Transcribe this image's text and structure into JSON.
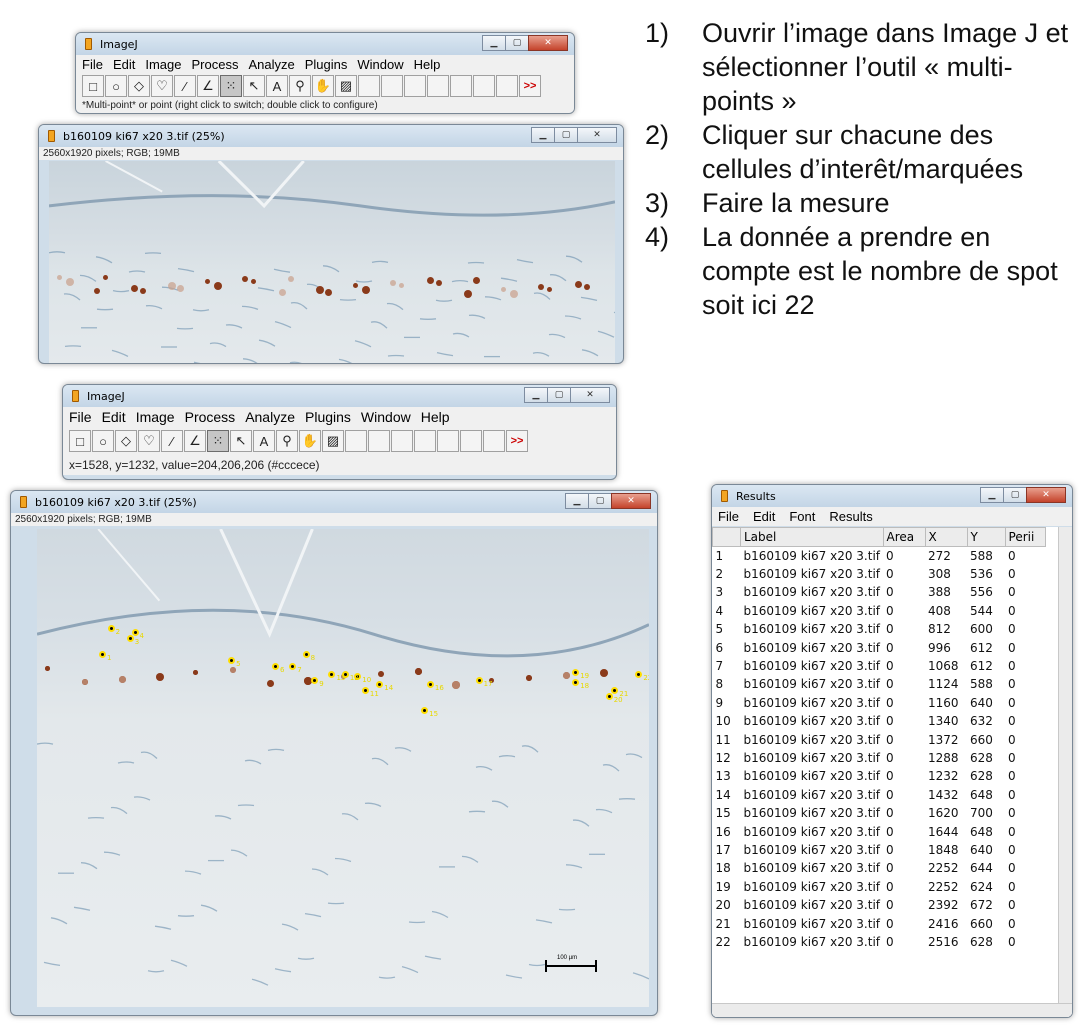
{
  "imagej1": {
    "title": "ImageJ",
    "menu": [
      "File",
      "Edit",
      "Image",
      "Process",
      "Analyze",
      "Plugins",
      "Window",
      "Help"
    ],
    "status": "*Multi-point* or point (right click to switch; double click to configure)"
  },
  "imgwin1": {
    "title": "b160109 ki67 x20 3.tif (25%)",
    "info": "2560x1920 pixels; RGB; 19MB"
  },
  "imagej2": {
    "title": "ImageJ",
    "menu": [
      "File",
      "Edit",
      "Image",
      "Process",
      "Analyze",
      "Plugins",
      "Window",
      "Help"
    ],
    "status": "x=1528, y=1232, value=204,206,206 (#cccece)"
  },
  "imgwin2": {
    "title": "b160109 ki67 x20 3.tif (25%)",
    "info": "2560x1920 pixels; RGB; 19MB",
    "scale_label": "100 µm"
  },
  "tool_more": ">>",
  "tools": [
    "rect-icon",
    "oval-icon",
    "polygon-icon",
    "freehand-icon",
    "line-icon",
    "angle-icon",
    "multipoint-icon",
    "wand-icon",
    "text-icon",
    "zoom-icon",
    "hand-icon",
    "dropper-icon"
  ],
  "instructions": [
    {
      "num": "1)",
      "text": "Ouvrir l’image dans Image J et sélectionner l’outil « multi-points »"
    },
    {
      "num": "2)",
      "text": "Cliquer sur chacune des cellules d’interêt/marquées"
    },
    {
      "num": "3)",
      "text": "Faire la mesure"
    },
    {
      "num": "4)",
      "text": "La donnée a prendre en compte est le nombre de spot soit ici 22"
    }
  ],
  "results": {
    "title": "Results",
    "menu": [
      "File",
      "Edit",
      "Font",
      "Results"
    ],
    "columns": [
      "",
      "Label",
      "Area",
      "X",
      "Y",
      "Perii"
    ],
    "rows": [
      [
        "1",
        "b160109 ki67 x20 3.tif",
        "0",
        "272",
        "588",
        "0"
      ],
      [
        "2",
        "b160109 ki67 x20 3.tif",
        "0",
        "308",
        "536",
        "0"
      ],
      [
        "3",
        "b160109 ki67 x20 3.tif",
        "0",
        "388",
        "556",
        "0"
      ],
      [
        "4",
        "b160109 ki67 x20 3.tif",
        "0",
        "408",
        "544",
        "0"
      ],
      [
        "5",
        "b160109 ki67 x20 3.tif",
        "0",
        "812",
        "600",
        "0"
      ],
      [
        "6",
        "b160109 ki67 x20 3.tif",
        "0",
        "996",
        "612",
        "0"
      ],
      [
        "7",
        "b160109 ki67 x20 3.tif",
        "0",
        "1068",
        "612",
        "0"
      ],
      [
        "8",
        "b160109 ki67 x20 3.tif",
        "0",
        "1124",
        "588",
        "0"
      ],
      [
        "9",
        "b160109 ki67 x20 3.tif",
        "0",
        "1160",
        "640",
        "0"
      ],
      [
        "10",
        "b160109 ki67 x20 3.tif",
        "0",
        "1340",
        "632",
        "0"
      ],
      [
        "11",
        "b160109 ki67 x20 3.tif",
        "0",
        "1372",
        "660",
        "0"
      ],
      [
        "12",
        "b160109 ki67 x20 3.tif",
        "0",
        "1288",
        "628",
        "0"
      ],
      [
        "13",
        "b160109 ki67 x20 3.tif",
        "0",
        "1232",
        "628",
        "0"
      ],
      [
        "14",
        "b160109 ki67 x20 3.tif",
        "0",
        "1432",
        "648",
        "0"
      ],
      [
        "15",
        "b160109 ki67 x20 3.tif",
        "0",
        "1620",
        "700",
        "0"
      ],
      [
        "16",
        "b160109 ki67 x20 3.tif",
        "0",
        "1644",
        "648",
        "0"
      ],
      [
        "17",
        "b160109 ki67 x20 3.tif",
        "0",
        "1848",
        "640",
        "0"
      ],
      [
        "18",
        "b160109 ki67 x20 3.tif",
        "0",
        "2252",
        "644",
        "0"
      ],
      [
        "19",
        "b160109 ki67 x20 3.tif",
        "0",
        "2252",
        "624",
        "0"
      ],
      [
        "20",
        "b160109 ki67 x20 3.tif",
        "0",
        "2392",
        "672",
        "0"
      ],
      [
        "21",
        "b160109 ki67 x20 3.tif",
        "0",
        "2416",
        "660",
        "0"
      ],
      [
        "22",
        "b160109 ki67 x20 3.tif",
        "0",
        "2516",
        "628",
        "0"
      ]
    ]
  }
}
